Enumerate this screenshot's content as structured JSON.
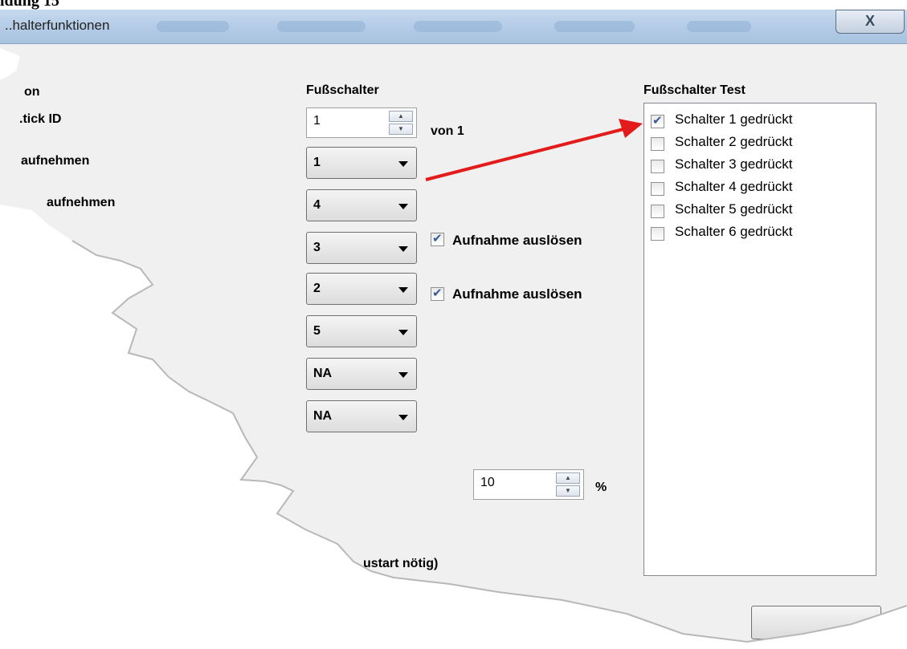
{
  "doc_heading": "ldung 15",
  "window": {
    "title": "..halterfunktionen",
    "close_glyph": "X"
  },
  "left_labels": [
    "on",
    ".tick ID",
    "aufnehmen",
    "aufnehmen"
  ],
  "footswitch": {
    "header": "Fußschalter",
    "id_spinner_value": "1",
    "of_label": "von 1",
    "combos": [
      "1",
      "4",
      "3",
      "2",
      "5",
      "NA",
      "NA"
    ],
    "trigger_checks": [
      {
        "label": "Aufnahme auslösen",
        "checked": true
      },
      {
        "label": "Aufnahme auslösen",
        "checked": true
      }
    ],
    "percent_value": "10",
    "percent_unit": "%",
    "restart_note": "ustart nötig)"
  },
  "test": {
    "header": "Fußschalter Test",
    "items": [
      {
        "label": "Schalter 1 gedrückt",
        "checked": true
      },
      {
        "label": "Schalter 2 gedrückt",
        "checked": false
      },
      {
        "label": "Schalter 3 gedrückt",
        "checked": false
      },
      {
        "label": "Schalter 4 gedrückt",
        "checked": false
      },
      {
        "label": "Schalter 5 gedrückt",
        "checked": false
      },
      {
        "label": "Schalter 6 gedrückt",
        "checked": false
      }
    ]
  },
  "colors": {
    "annotation_arrow": "#e31b1b",
    "panel_bg": "#f0f0f0",
    "titlebar": "#b3cbe6"
  },
  "icons": {
    "spinner_up": "up-arrow-icon",
    "spinner_down": "down-arrow-icon",
    "combo_arrow": "chevron-down-icon"
  }
}
